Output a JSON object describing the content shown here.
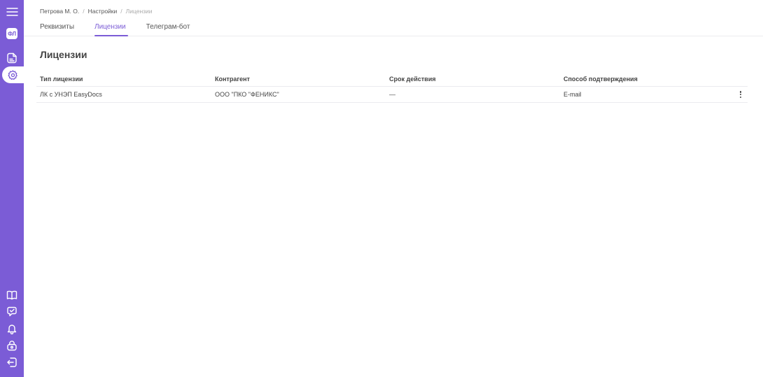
{
  "breadcrumb": {
    "items": [
      "Петрова М. О.",
      "Настройки",
      "Лицензии"
    ],
    "separator": "/"
  },
  "tabs": [
    {
      "label": "Реквизиты",
      "active": false
    },
    {
      "label": "Лицензии",
      "active": true
    },
    {
      "label": "Телеграм-бот",
      "active": false
    }
  ],
  "sidebar": {
    "avatar_initials": "ФЛ",
    "icons": [
      "menu-icon",
      "documents-icon",
      "settings-icon",
      "book-icon",
      "support-chat-icon",
      "bell-icon",
      "lock-icon",
      "logout-icon"
    ],
    "color": "#7b5cd6"
  },
  "page": {
    "title": "Лицензии"
  },
  "table": {
    "columns": [
      "Тип лицензии",
      "Контрагент",
      "Срок действия",
      "Способ подтверждения"
    ],
    "rows": [
      [
        "ЛК с УНЭП EasyDocs",
        "ООО \"ПКО \"ФЕНИКС\"",
        "—",
        "E-mail"
      ]
    ]
  },
  "colors": {
    "accent": "#7b5cd6",
    "border": "#ebebef"
  }
}
